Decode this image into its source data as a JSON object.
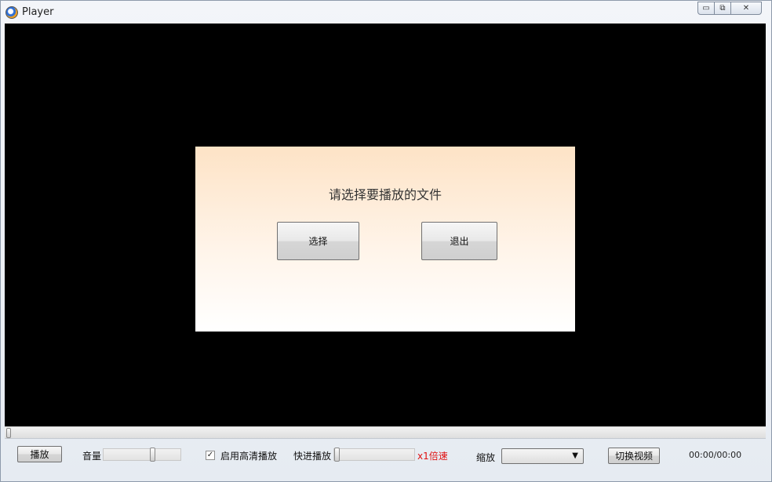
{
  "window": {
    "title": "Player",
    "minimize_glyph": "▭",
    "maximize_glyph": "⧉",
    "close_glyph": "✕"
  },
  "dialog": {
    "message": "请选择要播放的文件",
    "select_label": "选择",
    "exit_label": "退出"
  },
  "controls": {
    "play_label": "播放",
    "volume_label": "音量",
    "volume_level": 0.65,
    "hd_label": "启用高清播放",
    "hd_checked": true,
    "hd_check_glyph": "✓",
    "fast_forward_label": "快进播放",
    "fast_forward_level": 0.0,
    "speed_text": "x1倍速",
    "speed_color": "#e01010",
    "zoom_label": "缩放",
    "zoom_value": "",
    "zoom_arrow": "▼",
    "switch_video_label": "切换视频",
    "time_text": "00:00/00:00"
  },
  "progress": {
    "position": 0.0
  },
  "icons": [
    "app-icon",
    "minimize-icon",
    "maximize-icon",
    "close-icon",
    "check-icon",
    "dropdown-arrow-icon"
  ]
}
